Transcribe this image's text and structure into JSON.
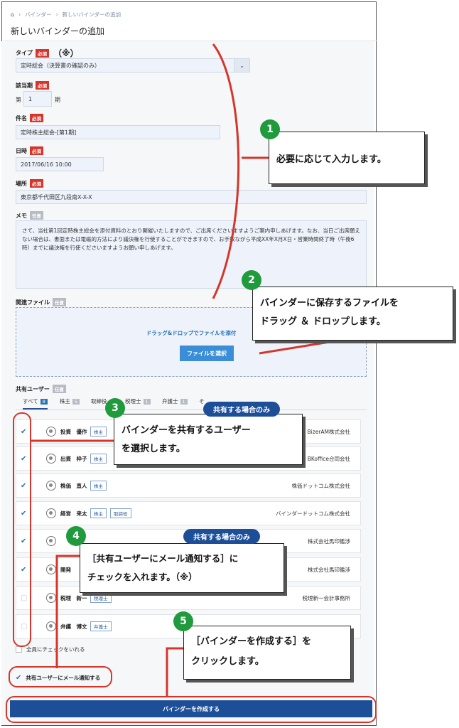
{
  "breadcrumb": {
    "level1": "バインダー",
    "level2": "新しいバインダーの追加"
  },
  "page_title": "新しいバインダーの追加",
  "form": {
    "type": {
      "label": "タイプ",
      "badge": "必須",
      "note": "（※）",
      "value": "定時総会（決算書の確認のみ）"
    },
    "period": {
      "label": "該当期",
      "badge": "必須",
      "prefix": "第",
      "value": "1",
      "suffix": "期"
    },
    "subject": {
      "label": "件名",
      "badge": "必須",
      "value": "定時株主総会-[第1期]"
    },
    "datetime": {
      "label": "日時",
      "badge": "必須",
      "value": "2017/06/16 10:00"
    },
    "place": {
      "label": "場所",
      "badge": "必須",
      "value": "東京都千代田区九段南X-X-X"
    },
    "memo": {
      "label": "メモ",
      "badge": "任意",
      "value": "さて、当社第1回定時株主総会を添付資料のとおり開催いたしますので、ご出席くださいますようご案内申しあげます。なお、当日ご出席願えない場合は、書面または電磁的方法により議決権を行使することができますので、お手数ながら平成XX年X月X日・営業時間終了時（午後6時）までに議決権を行使くださいますようお願い申しあげます。"
    },
    "files": {
      "label": "関連ファイル",
      "badge": "任意",
      "drop_text": "ドラッグ&ドロップでファイルを添付",
      "button": "ファイルを選択"
    }
  },
  "share": {
    "label": "共有ユーザー",
    "badge": "任意",
    "tabs": [
      {
        "label": "すべて",
        "count": "8"
      },
      {
        "label": "株主",
        "count": "5"
      },
      {
        "label": "取締役",
        "count": ""
      },
      {
        "label": "税理士",
        "count": "1"
      },
      {
        "label": "弁護士",
        "count": "1"
      },
      {
        "label": "そ",
        "count": ""
      }
    ],
    "users": [
      {
        "name": "投資　優作",
        "tags": [
          "株主"
        ],
        "company": "BizerAM株式会社",
        "checked": true
      },
      {
        "name": "出資　枠子",
        "tags": [
          "株主"
        ],
        "company": "BKoffice合同会社",
        "checked": true
      },
      {
        "name": "株価　直人",
        "tags": [
          "株主"
        ],
        "company": "株価ドットコム株式会社",
        "checked": true
      },
      {
        "name": "経営　来太",
        "tags": [
          "株主",
          "取締役"
        ],
        "company": "バインダードットコム株式会社",
        "checked": true
      },
      {
        "name": "",
        "tags": [],
        "company": "株式会社馬印鑑渉",
        "checked": true
      },
      {
        "name": "開発",
        "tags": [],
        "company": "株式会社馬印鑑渉",
        "checked": true
      },
      {
        "name": "税理　新一",
        "tags": [
          "税理士"
        ],
        "company": "税理新一会計事務所",
        "checked": false
      },
      {
        "name": "弁護　博文",
        "tags": [
          "弁護士"
        ],
        "company": "",
        "checked": false
      }
    ],
    "check_all": "全員にチェックをいれる",
    "notify": "共有ユーザーにメール通知する"
  },
  "create_button": "バインダーを作成する",
  "annotations": {
    "a1": {
      "num": "1",
      "text": "必要に応じて入力します。"
    },
    "a2": {
      "num": "2",
      "line1": "バインダーに保存するファイルを",
      "line2": "ドラッグ ＆ ドロップします。"
    },
    "a3": {
      "num": "3",
      "pill": "共有する場合のみ",
      "line1": "バインダーを共有するユーザー",
      "line2": "を選択します。"
    },
    "a4": {
      "num": "4",
      "pill": "共有する場合のみ",
      "line1": "［共有ユーザーにメール通知する］に",
      "line2": "チェックを入れます。（※）"
    },
    "a5": {
      "num": "5",
      "line1": "［バインダーを作成する］を",
      "line2": "クリックします。"
    }
  },
  "colors": {
    "accent": "#1d4f99",
    "required": "#d4362b",
    "annotation_green": "#1f9a3c",
    "annotation_red": "#d4362b"
  }
}
